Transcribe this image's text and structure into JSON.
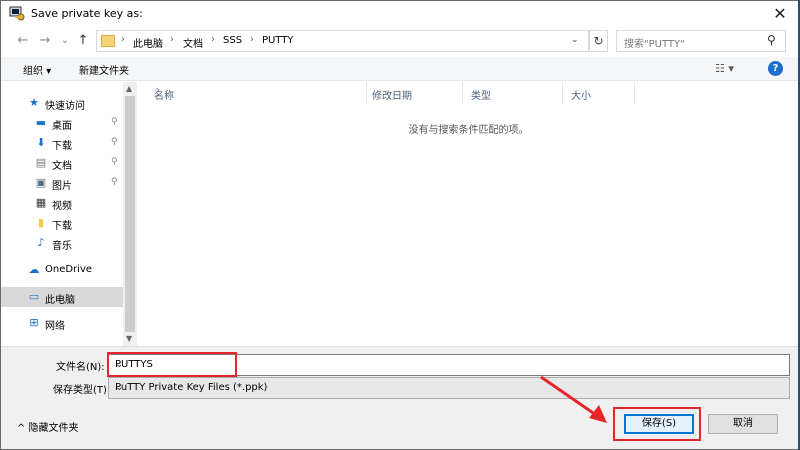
{
  "window": {
    "title": "Save private key as:",
    "close_glyph": "✕",
    "icon": "putty-key-icon"
  },
  "nav": {
    "back_glyph": "←",
    "forward_glyph": "→",
    "recent_glyph": "⌄",
    "up_glyph": "↑",
    "breadcrumbs": [
      "此电脑",
      "文档",
      "SSS",
      "PUTTY"
    ],
    "sep_glyph": "›",
    "dropdown_glyph": "⌄",
    "refresh_glyph": "↻",
    "search_placeholder": "搜索\"PUTTY\"",
    "search_glyph": "⚲"
  },
  "toolbar": {
    "organize_label": "组织 ▾",
    "new_folder_label": "新建文件夹",
    "view_glyph": "☷ ▾",
    "help_glyph": "?"
  },
  "sidebar": {
    "items": [
      {
        "label": "快速访问",
        "icon": "star-icon",
        "glyph": "★",
        "color": "#1e6ecb",
        "pinned": false
      },
      {
        "label": "桌面",
        "icon": "desktop-icon",
        "glyph": "▬",
        "color": "#1e78d0",
        "pinned": true
      },
      {
        "label": "下载",
        "icon": "download-icon",
        "glyph": "⬇",
        "color": "#1e6ecb",
        "pinned": true
      },
      {
        "label": "文档",
        "icon": "document-icon",
        "glyph": "▤",
        "color": "#7a7a7a",
        "pinned": true
      },
      {
        "label": "图片",
        "icon": "picture-icon",
        "glyph": "▣",
        "color": "#5a6a7a",
        "pinned": true
      },
      {
        "label": "视频",
        "icon": "video-icon",
        "glyph": "▦",
        "color": "#333333",
        "pinned": false
      },
      {
        "label": "下载",
        "icon": "folder-icon",
        "glyph": "▮",
        "color": "#f3c94c",
        "pinned": false
      },
      {
        "label": "音乐",
        "icon": "music-icon",
        "glyph": "♪",
        "color": "#1e6ecb",
        "pinned": false
      },
      {
        "label": "OneDrive",
        "icon": "cloud-icon",
        "glyph": "☁",
        "color": "#1e6ecb",
        "pinned": false
      },
      {
        "label": "此电脑",
        "icon": "computer-icon",
        "glyph": "▭",
        "color": "#1e78d0",
        "pinned": false,
        "selected": true
      },
      {
        "label": "网络",
        "icon": "network-icon",
        "glyph": "⊞",
        "color": "#1e6ecb",
        "pinned": false
      }
    ],
    "pin_glyph": "📌"
  },
  "columns": [
    "名称",
    "修改日期",
    "类型",
    "大小"
  ],
  "sort_glyph": "^",
  "empty_message": "没有与搜索条件匹配的项。",
  "form": {
    "filename_label": "文件名(N):",
    "filename_value": "PUTTYS",
    "filetype_label": "保存类型(T):",
    "filetype_value": "PuTTY Private Key Files (*.ppk)",
    "dropdown_glyph": "⌄",
    "hide_folders_label": "^ 隐藏文件夹",
    "save_label": "保存(S)",
    "cancel_label": "取消"
  },
  "colors": {
    "highlight_red": "#e8262a",
    "accent_blue": "#0078d7"
  }
}
